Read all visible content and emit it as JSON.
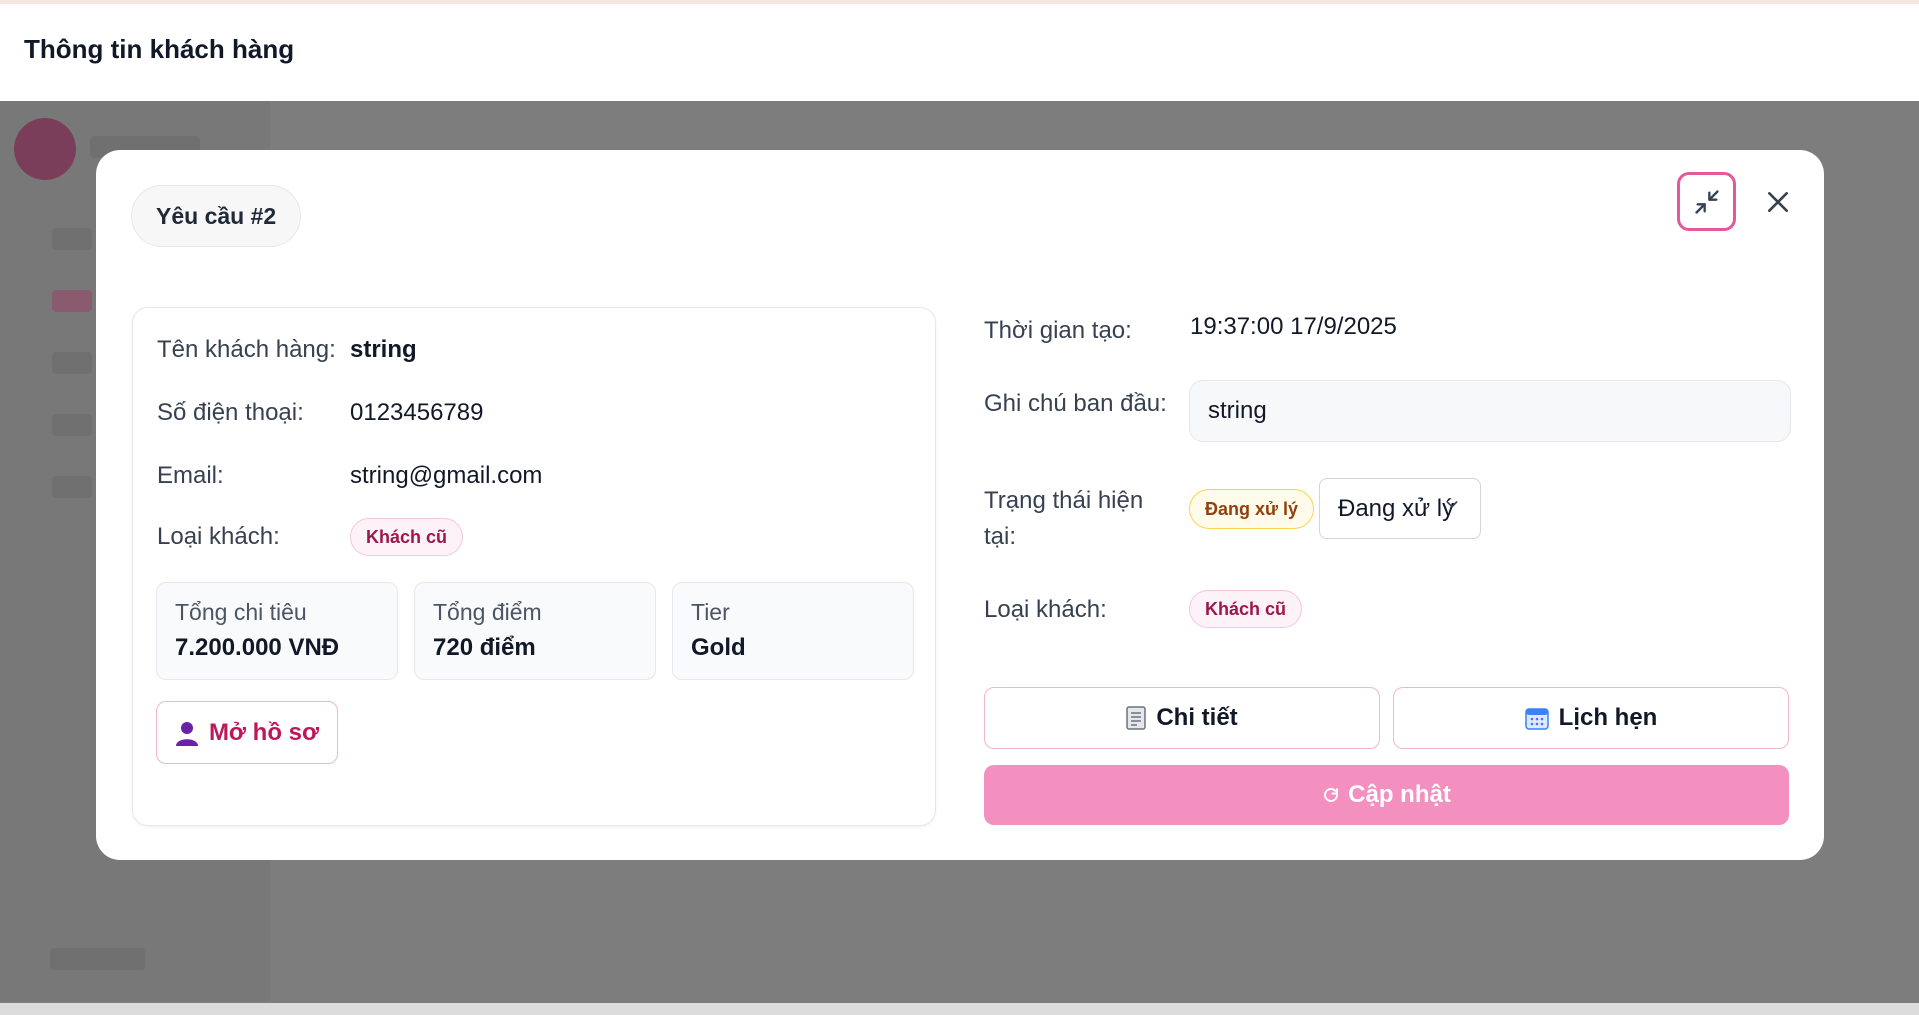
{
  "header": {
    "title": "Thông tin khách hàng"
  },
  "modal": {
    "request_label": "Yêu cầu #2",
    "customer": {
      "name_label": "Tên khách hàng:",
      "name_value": "string",
      "phone_label": "Số điện thoại:",
      "phone_value": "0123456789",
      "email_label": "Email:",
      "email_value": "string@gmail.com",
      "type_label": "Loại khách:",
      "type_value": "Khách cũ"
    },
    "stats": [
      {
        "label": "Tổng chi tiêu",
        "value": "7.200.000 VNĐ"
      },
      {
        "label": "Tổng điểm",
        "value": "720 điểm"
      },
      {
        "label": "Tier",
        "value": "Gold"
      }
    ],
    "open_profile_label": "Mở hồ sơ",
    "request": {
      "created_label": "Thời gian tạo:",
      "created_value": "19:37:00 17/9/2025",
      "note_label": "Ghi chú ban đầu:",
      "note_value": "string",
      "status_label": "Trạng thái hiện tại:",
      "status_badge": "Đang xử lý",
      "status_select_value": "Đang xử lý",
      "type_label": "Loại khách:",
      "type_value": "Khách cũ"
    },
    "buttons": {
      "detail_label": "Chi tiết",
      "appointment_label": "Lịch hẹn",
      "update_label": "Cập nhật"
    },
    "icons": {
      "minimize": "minimize-icon",
      "close": "close-icon",
      "profile": "user-icon",
      "detail": "document-icon",
      "appointment": "calendar-icon",
      "refresh": "refresh-icon"
    },
    "colors": {
      "accent": "#e35a9a",
      "update_button": "#f490c0",
      "tag_bg": "#fdf2f8",
      "status_bg": "#fffbeb"
    }
  }
}
